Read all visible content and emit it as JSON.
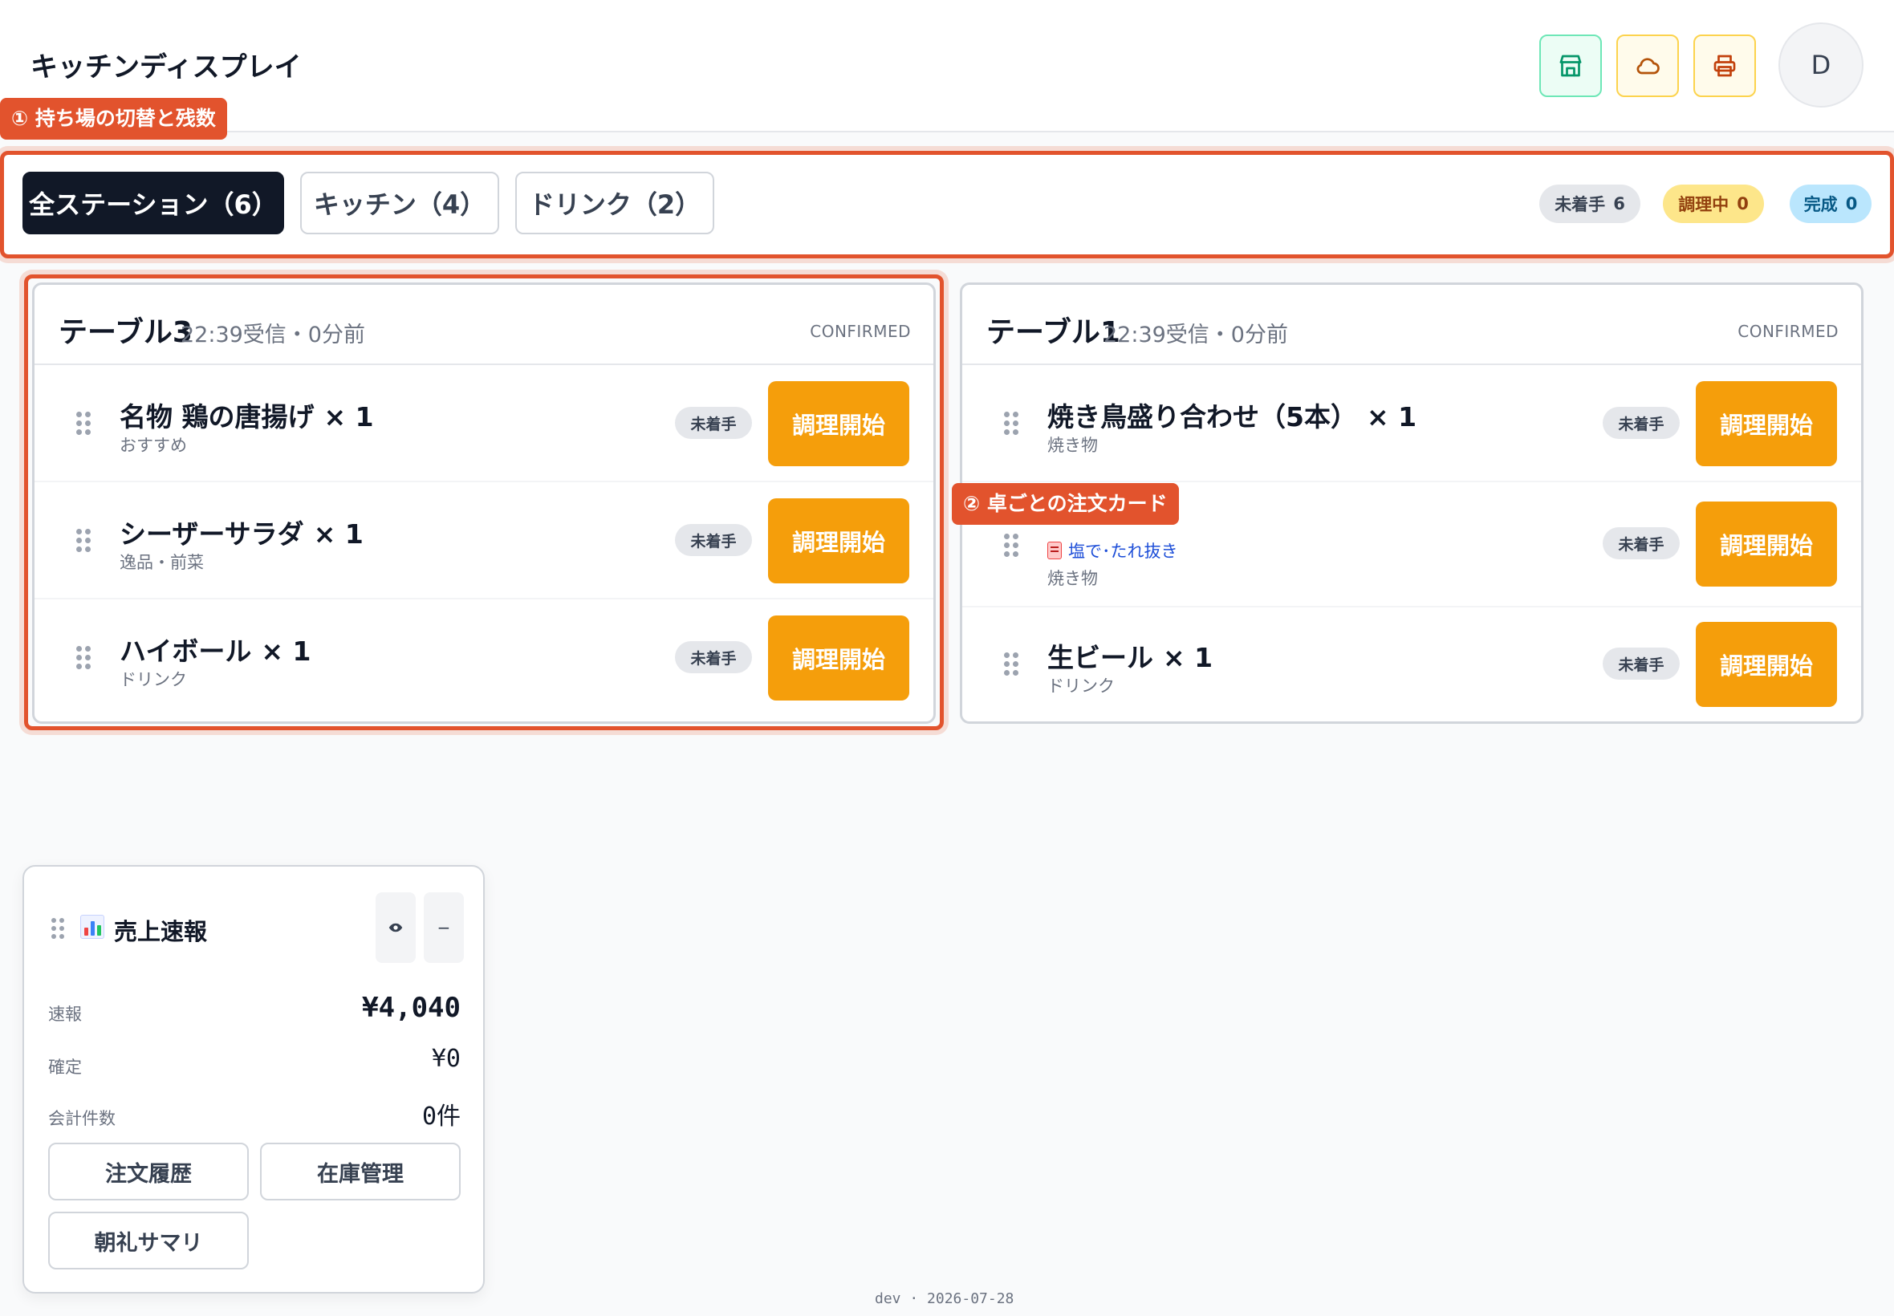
{
  "header": {
    "title": "キッチンディスプレイ",
    "buttons": [
      {
        "icon": "store-icon",
        "color": "#059669"
      },
      {
        "icon": "cloud-icon",
        "color": "#b45309"
      },
      {
        "icon": "printer-icon",
        "color": "#c2410c"
      }
    ],
    "avatar": "D"
  },
  "annotations": {
    "stations": "① 持ち場の切替と残数",
    "cards": "② 卓ごとの注文カード"
  },
  "tabs": [
    {
      "label": "全ステーション（6）",
      "active": true
    },
    {
      "label": "キッチン（4）",
      "active": false
    },
    {
      "label": "ドリンク（2）",
      "active": false
    }
  ],
  "counts": {
    "pending": {
      "label": "未着手",
      "value": "6"
    },
    "cooking": {
      "label": "調理中",
      "value": "0"
    },
    "done": {
      "label": "完成",
      "value": "0"
    }
  },
  "cards": [
    {
      "table": "テーブル3",
      "time": "22:39受信・0分前",
      "status": "CONFIRMED",
      "items": [
        {
          "name": "名物 鶏の唐揚げ",
          "qty": "× 1",
          "category": "おすすめ",
          "state": "未着手",
          "action": "調理開始"
        },
        {
          "name": "シーザーサラダ",
          "qty": "× 1",
          "category": "逸品・前菜",
          "state": "未着手",
          "action": "調理開始"
        },
        {
          "name": "ハイボール",
          "qty": "× 1",
          "category": "ドリンク",
          "state": "未着手",
          "action": "調理開始"
        }
      ]
    },
    {
      "table": "テーブル1",
      "time": "22:39受信・0分前",
      "status": "CONFIRMED",
      "items": [
        {
          "name": "焼き鳥盛り合わせ（5本）",
          "qty": "× 1",
          "category": "焼き物",
          "state": "未着手",
          "action": "調理開始"
        },
        {
          "name": "",
          "qty": "",
          "note": "塩で･たれ抜き",
          "category": "焼き物",
          "state": "未着手",
          "action": "調理開始"
        },
        {
          "name": "生ビール",
          "qty": "× 1",
          "category": "ドリンク",
          "state": "未着手",
          "action": "調理開始"
        }
      ]
    }
  ],
  "sales": {
    "title": "売上速報",
    "rows": [
      {
        "label": "速報",
        "value": "¥4,040"
      },
      {
        "label": "確定",
        "value": "¥0"
      },
      {
        "label": "会計件数",
        "value": "0件"
      }
    ],
    "buttons": [
      "注文履歴",
      "在庫管理",
      "朝礼サマリ"
    ],
    "eye_icon": "eye-icon",
    "minimize": "−"
  },
  "footer": "dev · 2026-07-28"
}
